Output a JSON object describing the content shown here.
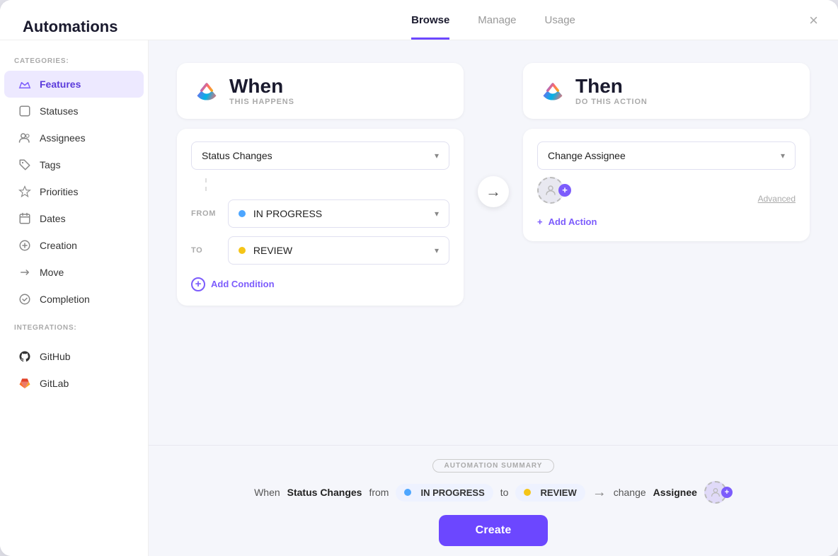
{
  "modal": {
    "title": "Automations",
    "close_label": "×"
  },
  "tabs": [
    {
      "label": "Browse",
      "active": true
    },
    {
      "label": "Manage",
      "active": false
    },
    {
      "label": "Usage",
      "active": false
    }
  ],
  "sidebar": {
    "categories_label": "CATEGORIES:",
    "integrations_label": "INTEGRATIONS:",
    "categories": [
      {
        "label": "Features",
        "active": true,
        "icon": "👑"
      },
      {
        "label": "Statuses",
        "active": false,
        "icon": "◻"
      },
      {
        "label": "Assignees",
        "active": false,
        "icon": "👤"
      },
      {
        "label": "Tags",
        "active": false,
        "icon": "🏷"
      },
      {
        "label": "Priorities",
        "active": false,
        "icon": "⚑"
      },
      {
        "label": "Dates",
        "active": false,
        "icon": "📅"
      },
      {
        "label": "Creation",
        "active": false,
        "icon": "➕"
      },
      {
        "label": "Move",
        "active": false,
        "icon": "↗"
      },
      {
        "label": "Completion",
        "active": false,
        "icon": "✓"
      }
    ],
    "integrations": [
      {
        "label": "GitHub",
        "icon": "github"
      },
      {
        "label": "GitLab",
        "icon": "gitlab"
      }
    ]
  },
  "when_panel": {
    "title": "When",
    "subtitle": "THIS HAPPENS",
    "trigger_label": "Status Changes",
    "from_label": "FROM",
    "from_status": "IN PROGRESS",
    "from_color": "blue",
    "to_label": "TO",
    "to_status": "REVIEW",
    "to_color": "yellow",
    "add_condition_label": "Add Condition"
  },
  "then_panel": {
    "title": "Then",
    "subtitle": "DO THIS ACTION",
    "action_label": "Change Assignee",
    "advanced_label": "Advanced",
    "add_action_label": "Add Action"
  },
  "summary": {
    "label": "AUTOMATION SUMMARY",
    "when_text": "When",
    "status_changes_text": "Status Changes",
    "from_text": "from",
    "in_progress_text": "IN PROGRESS",
    "to_text": "to",
    "review_text": "REVIEW",
    "change_text": "change",
    "assignee_text": "Assignee",
    "in_progress_color": "blue",
    "review_color": "yellow"
  },
  "create_button_label": "Create"
}
